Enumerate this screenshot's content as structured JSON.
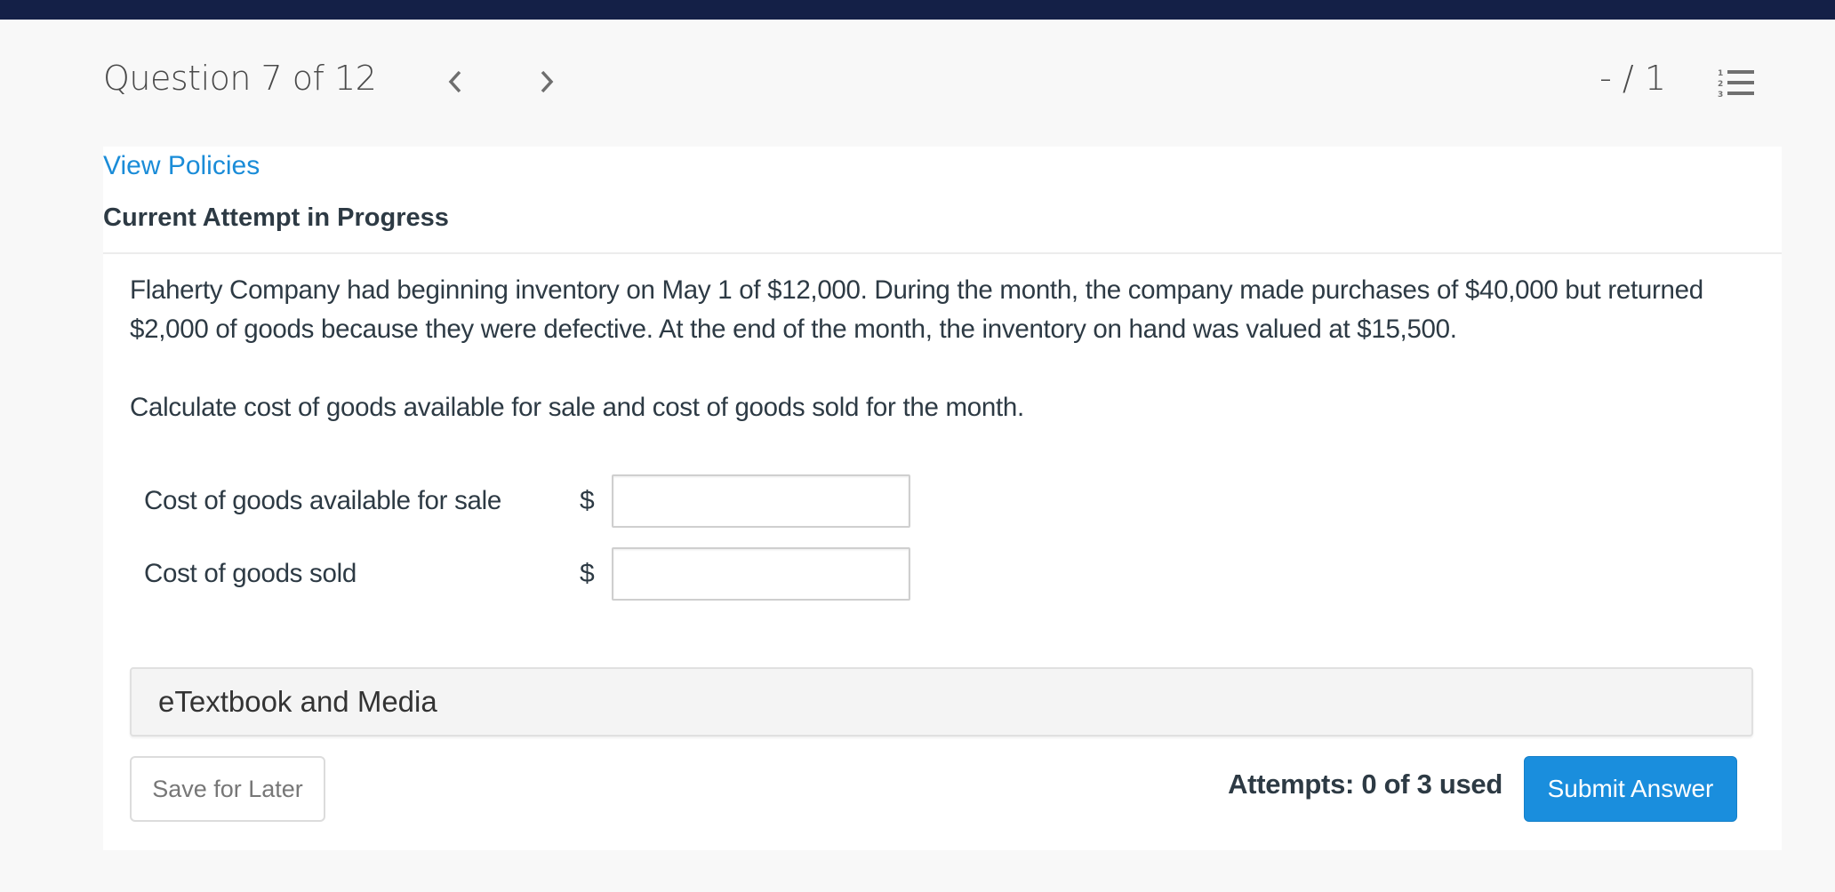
{
  "header": {
    "question_label": "Question 7 of 12",
    "prev_icon": "chevron-left-icon",
    "next_icon": "chevron-right-icon",
    "score": "- / 1",
    "list_icon": "numbered-list-icon"
  },
  "card": {
    "view_policies": "View Policies",
    "attempt_title": "Current Attempt in Progress",
    "question_paragraph": "Flaherty Company had beginning inventory on May 1 of $12,000. During the month, the company made purchases of $40,000 but returned $2,000 of goods because they were defective. At the end of the month, the inventory on hand was valued at $15,500.",
    "instruction": "Calculate cost of goods available for sale and cost of goods sold for the month.",
    "fields": [
      {
        "label": "Cost of goods available for sale",
        "currency": "$",
        "value": "",
        "placeholder": ""
      },
      {
        "label": "Cost of goods sold",
        "currency": "$",
        "value": "",
        "placeholder": ""
      }
    ],
    "etextbook_label": "eTextbook and Media",
    "save_label": "Save for Later",
    "attempts": "Attempts: 0 of 3 used",
    "submit_label": "Submit Answer"
  },
  "colors": {
    "topbar": "#142047",
    "link": "#1a8cd8",
    "submit": "#1a8edd",
    "text": "#2d3a44"
  }
}
